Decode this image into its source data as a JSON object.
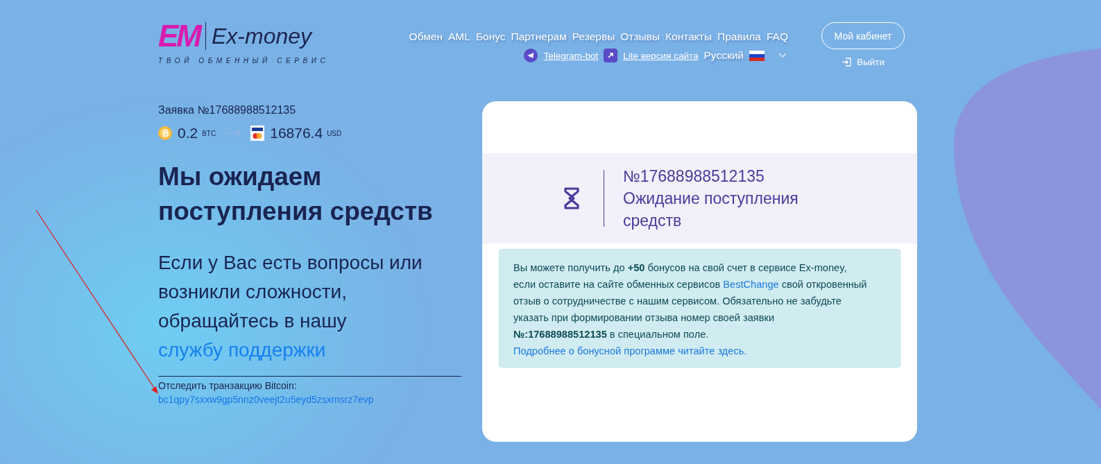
{
  "logo": {
    "mark": "EM",
    "name": "Ex-money",
    "tagline": "ТВОЙ ОБМЕННЫЙ СЕРВИС"
  },
  "nav": [
    "Обмен",
    "AML",
    "Бонус",
    "Партнерам",
    "Резервы",
    "Отзывы",
    "Контакты",
    "Правила",
    "FAQ"
  ],
  "sub_nav": {
    "telegram": "Telegram-bot",
    "lite": "Lite версия сайта",
    "language": "Русский"
  },
  "account": {
    "cabinet": "Мой кабинет",
    "logout": "Выйти"
  },
  "order": {
    "title": "Заявка №17688988512135",
    "give_amount": "0.2",
    "give_currency": "BTC",
    "get_amount": "16876.4",
    "get_currency": "USD"
  },
  "heading": "Мы ожидаем поступления средств",
  "support": {
    "text": "Если у Вас есть вопросы или возникли сложности, обращайтесь в нашу",
    "link": "службу поддержки"
  },
  "track": {
    "label": "Отследить транзакцию Bitcoin:",
    "link": "bc1qpy7sxxw9gp5nnz0veejt2u5eyd5zsxmsrz7evp"
  },
  "status": {
    "number": "№17688988512135",
    "text": "Ожидание поступления средств"
  },
  "bonus_notice": [
    {
      "kind": "text",
      "text": "Вы можете получить до **+50** бонусов на свой счет в сервисе Ex-money, если оставите на сайте обменных сервисов "
    },
    {
      "kind": "link",
      "text": "BestChange"
    },
    {
      "kind": "text",
      "text": " свой откровенный отзыв о сотрудничестве с нашим сервисом. Обязательно не забудьте указать при формировании отзыва номер своей заявки **№:17688988512135** в специальном поле. "
    },
    {
      "kind": "link",
      "text": "Подробнее о бонусной программе читайте здесь."
    }
  ]
}
